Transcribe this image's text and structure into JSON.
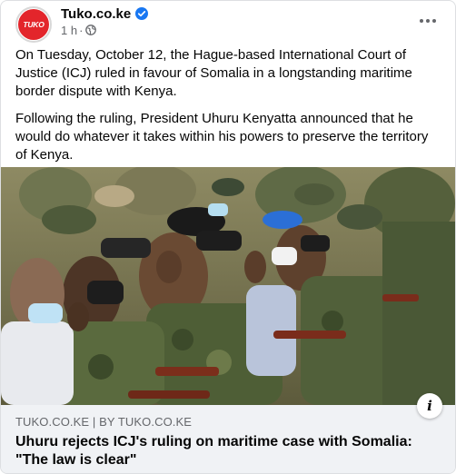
{
  "post": {
    "page_name": "Tuko.co.ke",
    "avatar_text": "TUKO",
    "timestamp": "1 h",
    "separator": "·",
    "verified_icon": "verified-badge-icon",
    "audience_icon": "globe-icon",
    "more_icon": "more-options-icon",
    "paragraphs": [
      "On Tuesday, October 12, the Hague-based International Court of Justice (ICJ) ruled in favour of Somalia in a longstanding maritime border dispute with Kenya.",
      "Following the ruling, President Uhuru Kenyatta announced that he would do whatever it takes within his powers to preserve the territory of Kenya."
    ]
  },
  "link_preview": {
    "domain_line": "TUKO.CO.KE | BY TUKO.CO.KE",
    "title": "Uhuru rejects ICJ's ruling on maritime case with Somalia: \"The law is clear\"",
    "info_icon": "info-icon",
    "info_glyph": "i"
  },
  "colors": {
    "brand_red": "#e3252b",
    "verified_blue": "#1877f2",
    "secondary_text": "#65676b",
    "preview_bg": "#f0f2f5"
  }
}
